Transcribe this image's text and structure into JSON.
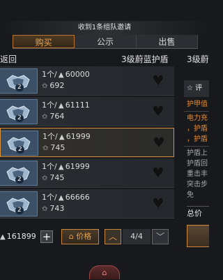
{
  "notice": "收到1条组队邀请",
  "tabs": [
    {
      "label": "购买",
      "active": true
    },
    {
      "label": "公示",
      "active": false
    },
    {
      "label": "出售",
      "active": false
    }
  ],
  "back_label": "返回",
  "item_title": "3级蔚蓝护盾",
  "detail_title": "3级蔚",
  "items": [
    {
      "level": "2",
      "qty": "1个/",
      "price": "60000",
      "bids": "692",
      "selected": false
    },
    {
      "level": "2",
      "qty": "1个/",
      "price": "61111",
      "bids": "764",
      "selected": false
    },
    {
      "level": "2",
      "qty": "1个/",
      "price": "61999",
      "bids": "745",
      "selected": true
    },
    {
      "level": "2",
      "qty": "1个/",
      "price": "61999",
      "bids": "745",
      "selected": false
    },
    {
      "level": "2",
      "qty": "1个/",
      "price": "66666",
      "bids": "743",
      "selected": false
    }
  ],
  "detail": {
    "eval_label": "评",
    "line1": "护甲值",
    "line2": "电力充",
    "line3": "，护盾",
    "line4": "，护盾",
    "line5": "护盾上",
    "line6": "护盾回",
    "line7": "重击丰",
    "line8": "突击步",
    "line9": "免"
  },
  "total_label": "总价",
  "balance": "161899",
  "price_sort_label": "价格",
  "pager": "4/4",
  "colors": {
    "accent": "#d9913d",
    "detail_orange": "#e78c34"
  }
}
